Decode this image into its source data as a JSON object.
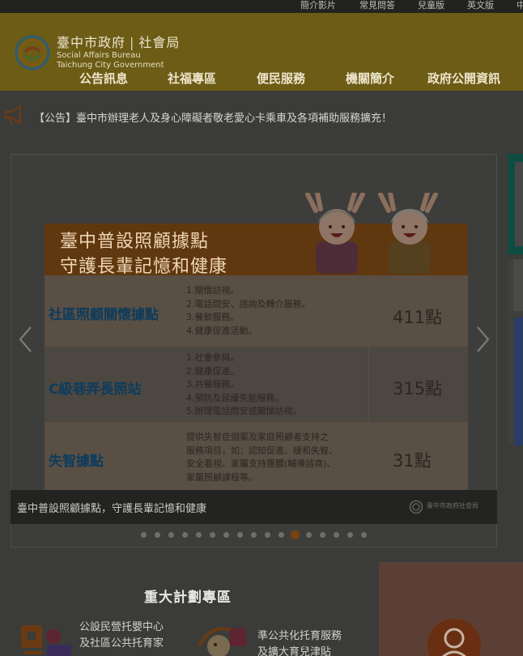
{
  "topbar": [
    "簡介影片",
    "常見問答",
    "兒童版",
    "英文版",
    "中"
  ],
  "brand": {
    "title": "臺中市政府",
    "unit": "社會局",
    "en1": "Social Affairs Bureau",
    "en2": "Taichung City Government"
  },
  "nav": [
    "公告訊息",
    "社福專區",
    "便民服務",
    "機關簡介",
    "政府公開資訊"
  ],
  "notice": "【公告】臺中市辦理老人及身心障礙者敬老愛心卡乘車及各項補助服務擴充！",
  "banner": {
    "title1": "臺中普設照顧據點",
    "title2": "守護長輩記憶和健康",
    "rows": [
      {
        "name": "社區照顧關懷據點",
        "items": [
          "1.關懷訪視。",
          "2.電話問安、諮詢及轉介服務。",
          "3.餐飲服務。",
          "4.健康促進活動。"
        ],
        "count": "411點"
      },
      {
        "name": "C級巷弄長照站",
        "items": [
          "1.社會參與。",
          "2.健康促進。",
          "3.共餐服務。",
          "4.預防及延緩失能服務。",
          "5.辦理電話問安或關懷訪視。"
        ],
        "count": "315點"
      },
      {
        "name": "失智據點",
        "items": [
          "提供失智症個案及家庭照顧者支持之",
          "服務項目，如：認知促進、緩和失智、",
          "安全看視、家屬支持團體(輔導諮商)、",
          "家屬照顧課程等。"
        ],
        "count": "31點"
      }
    ]
  },
  "caption": "臺中普設照顧據點，守護長輩記憶和健康",
  "caption_logo": "臺中市政府社會局",
  "dots": {
    "total": 17,
    "active": 11
  },
  "section": {
    "title": "重大計劃專區",
    "items": [
      {
        "line1": "公設民營托嬰中心",
        "line2": "及社區公共托育家"
      },
      {
        "line1": "準公共化托育服務",
        "line2": "及擴大育兒津貼"
      }
    ]
  }
}
